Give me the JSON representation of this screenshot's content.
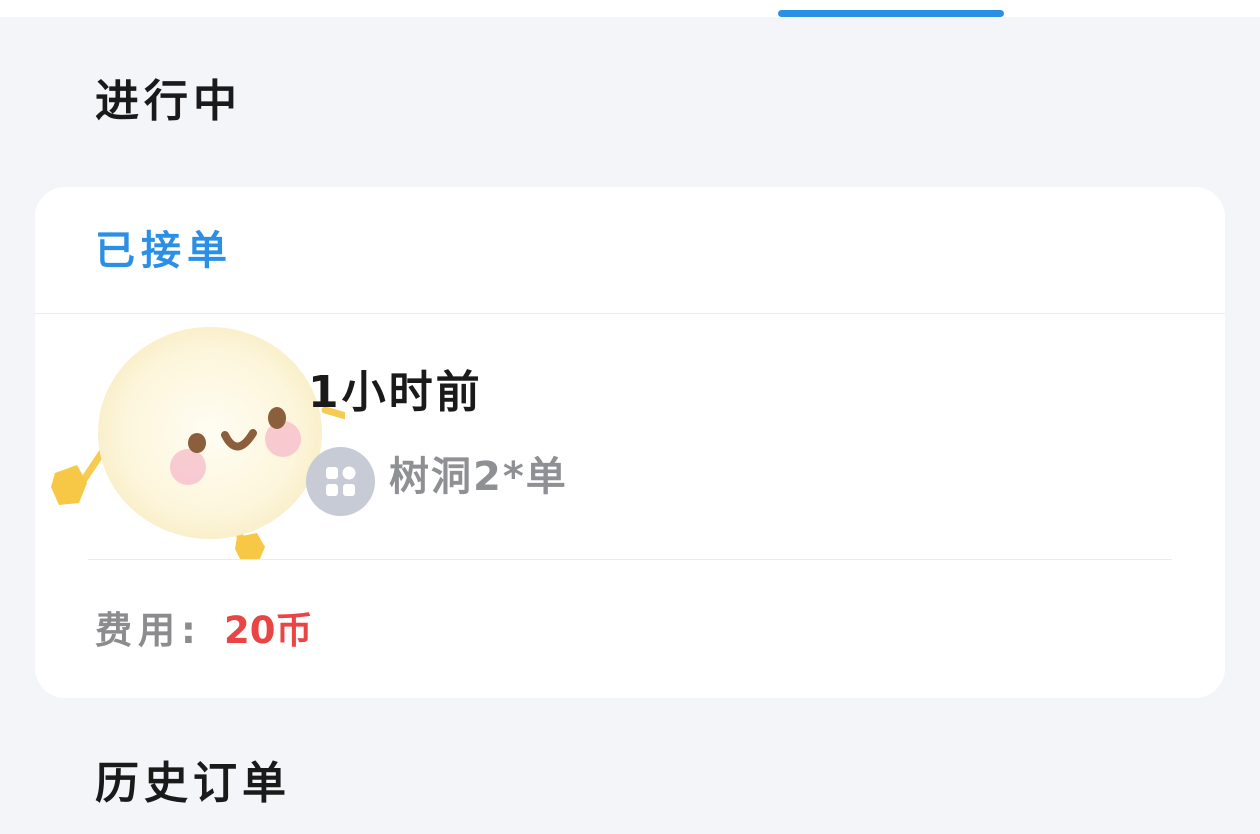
{
  "top_tabs": {
    "active_indicator_color": "#2b8fe6"
  },
  "sections": {
    "ongoing_title": "进行中",
    "history_title": "历史订单"
  },
  "order": {
    "status": "已接单",
    "status_color": "#2b8fe6",
    "time": "1小时前",
    "group_icon": "grid-apps-icon",
    "group_name": "树洞2*单",
    "fee_label": "费用:",
    "fee_value": "20币",
    "fee_color": "#ea4545",
    "illustration": "mascot-sticker"
  }
}
